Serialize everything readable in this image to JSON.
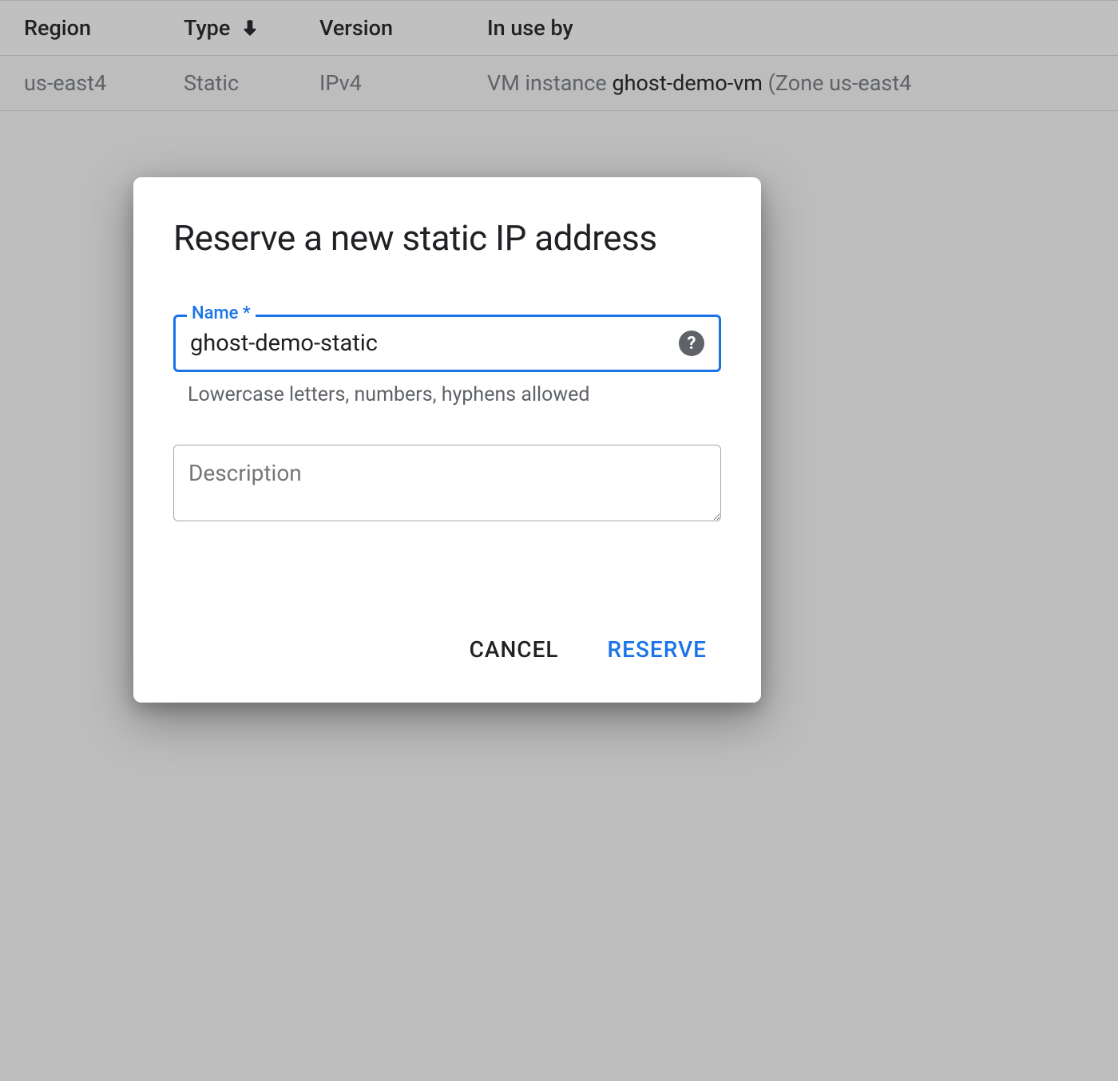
{
  "table": {
    "headers": {
      "region": "Region",
      "type": "Type",
      "version": "Version",
      "in_use_by": "In use by"
    },
    "row": {
      "region": "us-east4",
      "type": "Static",
      "version": "IPv4",
      "in_use_prefix": "VM instance ",
      "in_use_name": "ghost-demo-vm",
      "in_use_suffix": " (Zone us-east4"
    }
  },
  "dialog": {
    "title": "Reserve a new static IP address",
    "name_field": {
      "label": "Name *",
      "value": "ghost-demo-static",
      "hint": "Lowercase letters, numbers, hyphens allowed"
    },
    "description_field": {
      "placeholder": "Description",
      "value": ""
    },
    "actions": {
      "cancel": "CANCEL",
      "reserve": "RESERVE"
    },
    "help_icon_glyph": "?"
  }
}
